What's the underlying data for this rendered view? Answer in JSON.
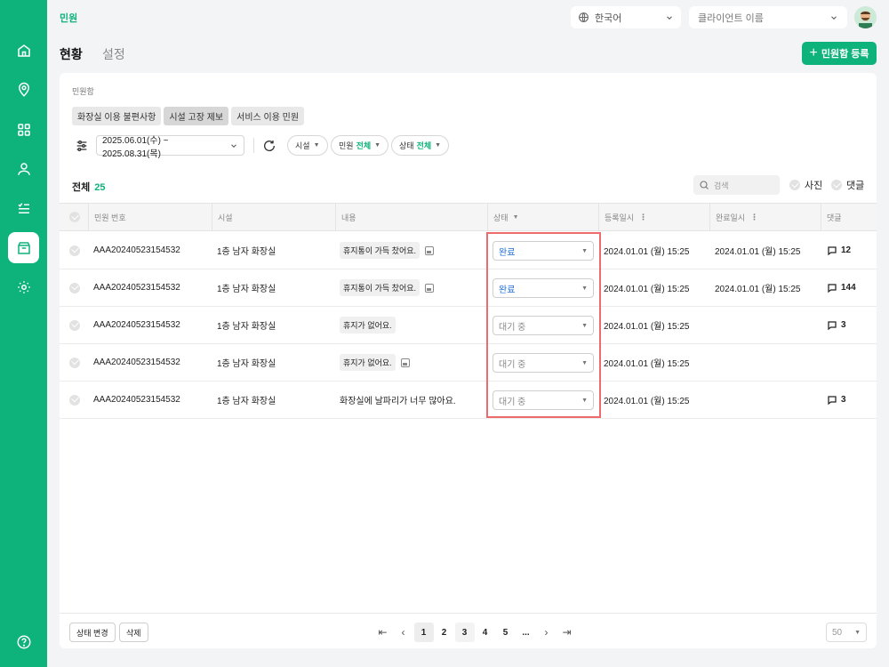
{
  "breadcrumb": "민원",
  "language": {
    "value": "한국어"
  },
  "client": {
    "placeholder": "클라이언트 이름"
  },
  "tabs": {
    "status": "현황",
    "settings": "설정"
  },
  "add_button": "민원함 등록",
  "inbox": {
    "label": "민원함",
    "chips": [
      "화장실 이용 불편사항",
      "시설 고장 제보",
      "서비스 이용 민원"
    ]
  },
  "filters": {
    "date_range": "2025.06.01(수) ~ 2025.08.31(목)",
    "facility": "시설",
    "complaint": {
      "label": "민원",
      "value": "전체"
    },
    "state": {
      "label": "상태",
      "value": "전체"
    }
  },
  "summary": {
    "label": "전체",
    "count": "25"
  },
  "search": {
    "placeholder": "검색"
  },
  "toggles": {
    "photo": "사진",
    "comment": "댓글"
  },
  "columns": {
    "id": "민원 번호",
    "facility": "시설",
    "content": "내용",
    "status": "상태",
    "registered": "등록일시",
    "completed": "완료일시",
    "comments": "댓글"
  },
  "rows": [
    {
      "id": "AAA20240523154532",
      "facility": "1층 남자 화장실",
      "content": "휴지통이 가득 찼어요.",
      "status": "완료",
      "registered": "2024.01.01 (월) 15:25",
      "completed": "2024.01.01 (월) 15:25",
      "comments": "12"
    },
    {
      "id": "AAA20240523154532",
      "facility": "1층 남자 화장실",
      "content": "휴지통이 가득 찼어요.",
      "status": "완료",
      "registered": "2024.01.01 (월) 15:25",
      "completed": "2024.01.01 (월) 15:25",
      "comments": "144"
    },
    {
      "id": "AAA20240523154532",
      "facility": "1층 남자 화장실",
      "content": "휴지가 없어요.",
      "status": "대기 중",
      "registered": "2024.01.01 (월) 15:25",
      "completed": "",
      "comments": "3"
    },
    {
      "id": "AAA20240523154532",
      "facility": "1층 남자 화장실",
      "content": "휴지가 없어요.",
      "status": "대기 중",
      "registered": "2024.01.01 (월) 15:25",
      "completed": "",
      "comments": ""
    },
    {
      "id": "AAA20240523154532",
      "facility": "1층 남자 화장실",
      "content": "화장실에 날파리가 너무 많아요.",
      "status": "대기 중",
      "registered": "2024.01.01 (월) 15:25",
      "completed": "",
      "comments": "3"
    }
  ],
  "footer": {
    "change_status": "상태 변경",
    "delete": "삭제",
    "pages": [
      "1",
      "2",
      "3",
      "4",
      "5",
      "..."
    ],
    "per_page": "50"
  },
  "colors": {
    "brand": "#0eb27b",
    "done": "#1f6fd6",
    "highlight": "#ef6b6b"
  }
}
